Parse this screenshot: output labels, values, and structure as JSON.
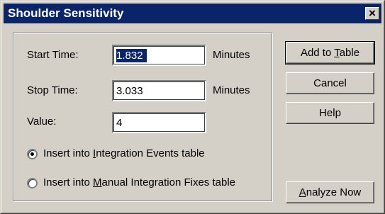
{
  "window": {
    "title": "Shoulder Sensitivity",
    "close_glyph": "×"
  },
  "fields": {
    "start_time": {
      "label": "Start Time:",
      "value": "1.832",
      "unit": "Minutes"
    },
    "stop_time": {
      "label": "Stop Time:",
      "value": "3.033",
      "unit": "Minutes"
    },
    "value": {
      "label": "Value:",
      "value": "4"
    }
  },
  "options": [
    {
      "pre": "Insert into ",
      "key": "I",
      "post": "ntegration Events table",
      "selected": true
    },
    {
      "pre": "Insert into ",
      "key": "M",
      "post": "anual Integration Fixes table",
      "selected": false
    }
  ],
  "buttons": {
    "add_to_table": {
      "pre": "Add to ",
      "key": "T",
      "post": "able"
    },
    "cancel": {
      "label": "Cancel"
    },
    "help": {
      "label": "Help"
    },
    "analyze_now": {
      "pre": "",
      "key": "A",
      "post": "nalyze Now"
    }
  },
  "colors": {
    "face": "#d4d0c8",
    "titlebar": "#0a246a",
    "selection": "#0a246a"
  }
}
